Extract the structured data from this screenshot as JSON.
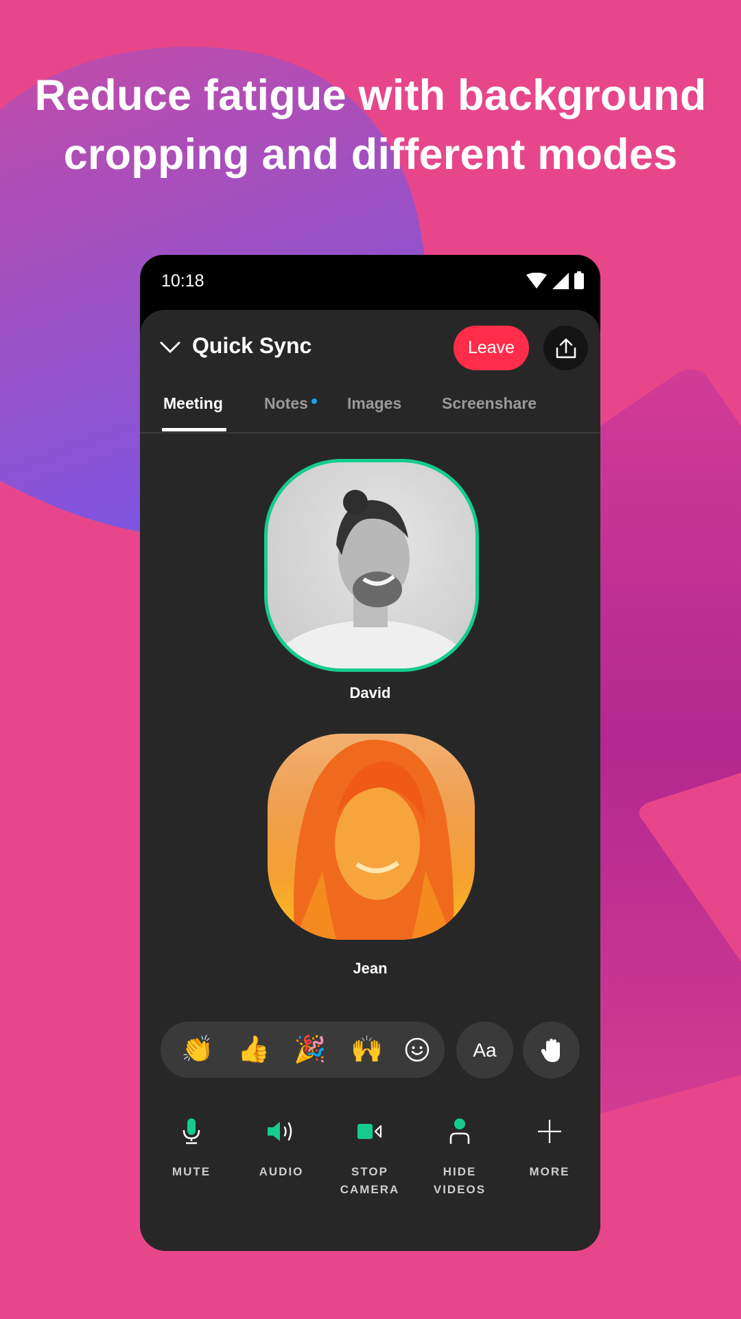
{
  "headline": {
    "line1": "Reduce fatigue with background",
    "line2": "cropping and different modes"
  },
  "status_bar": {
    "time": "10:18",
    "icons": [
      "wifi-icon",
      "cellular-signal-icon",
      "battery-icon"
    ]
  },
  "header": {
    "collapse_icon": "chevron-down-icon",
    "title": "Quick Sync",
    "leave_label": "Leave",
    "share_icon": "share-upload-icon"
  },
  "tabs": [
    {
      "label": "Meeting",
      "active": true
    },
    {
      "label": "Notes",
      "active": false,
      "has_notification_dot": true
    },
    {
      "label": "Images",
      "active": false
    },
    {
      "label": "Screenshare",
      "active": false
    }
  ],
  "participants": [
    {
      "name": "David",
      "speaking": true,
      "filter": "grayscale"
    },
    {
      "name": "Jean",
      "speaking": false,
      "filter": "orange-duotone"
    }
  ],
  "reactions": {
    "emojis": [
      {
        "name": "clapping-hands",
        "glyph": "👏"
      },
      {
        "name": "thumbs-up",
        "glyph": "👍"
      },
      {
        "name": "party-popper",
        "glyph": "🎉"
      },
      {
        "name": "raising-hands",
        "glyph": "🙌"
      }
    ],
    "more_emoji_icon": "smiley-face-icon",
    "text_button_label": "Aa",
    "raise_hand_icon": "raised-hand-icon"
  },
  "controls": [
    {
      "icon": "microphone-icon",
      "label_line1": "MUTE",
      "label_line2": ""
    },
    {
      "icon": "speaker-icon",
      "label_line1": "AUDIO",
      "label_line2": ""
    },
    {
      "icon": "video-camera-icon",
      "label_line1": "STOP",
      "label_line2": "CAMERA"
    },
    {
      "icon": "person-icon",
      "label_line1": "HIDE",
      "label_line2": "VIDEOS"
    },
    {
      "icon": "plus-icon",
      "label_line1": "MORE",
      "label_line2": ""
    }
  ],
  "colors": {
    "background": "#E8468A",
    "accent_green": "#15CC8C",
    "leave_red": "#FF2D4A",
    "sheet_dark": "#272727",
    "notification_dot": "#1DA1F2"
  }
}
